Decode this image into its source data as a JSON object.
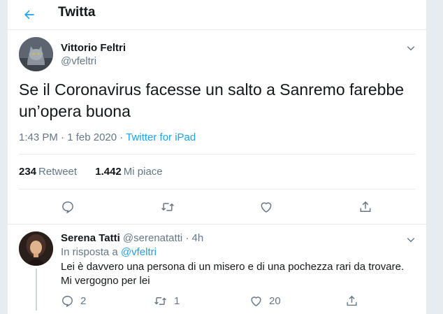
{
  "header": {
    "title": "Twitta",
    "back_icon": "arrow-left-icon",
    "accent_color": "#1da1f2"
  },
  "tweet": {
    "author_name": "Vittorio Feltri",
    "author_handle": "@vfeltri",
    "text_line1": "Se il Coronavirus facesse un salto a Sanremo farebbe",
    "text_line2": "un’opera buona",
    "time": "1:43 PM",
    "date": "1 feb 2020",
    "dot": "·",
    "source": "Twitter for iPad",
    "retweets_count": "234",
    "retweets_label": "Retweet",
    "likes_count": "1.442",
    "likes_label": "Mi piace"
  },
  "reply": {
    "author_name": "Serena Tatti",
    "author_handle": "@serenatatti",
    "dot": "·",
    "time_ago": "4h",
    "in_reply_prefix": "In risposta a ",
    "in_reply_handle": "@vfeltri",
    "text_line1": "Lei è davvero una persona di un misero e di una pochezza rari da trovare.",
    "text_line2": "Mi vergogno per lei",
    "reply_count": "2",
    "retweet_count": "1",
    "like_count": "20"
  }
}
